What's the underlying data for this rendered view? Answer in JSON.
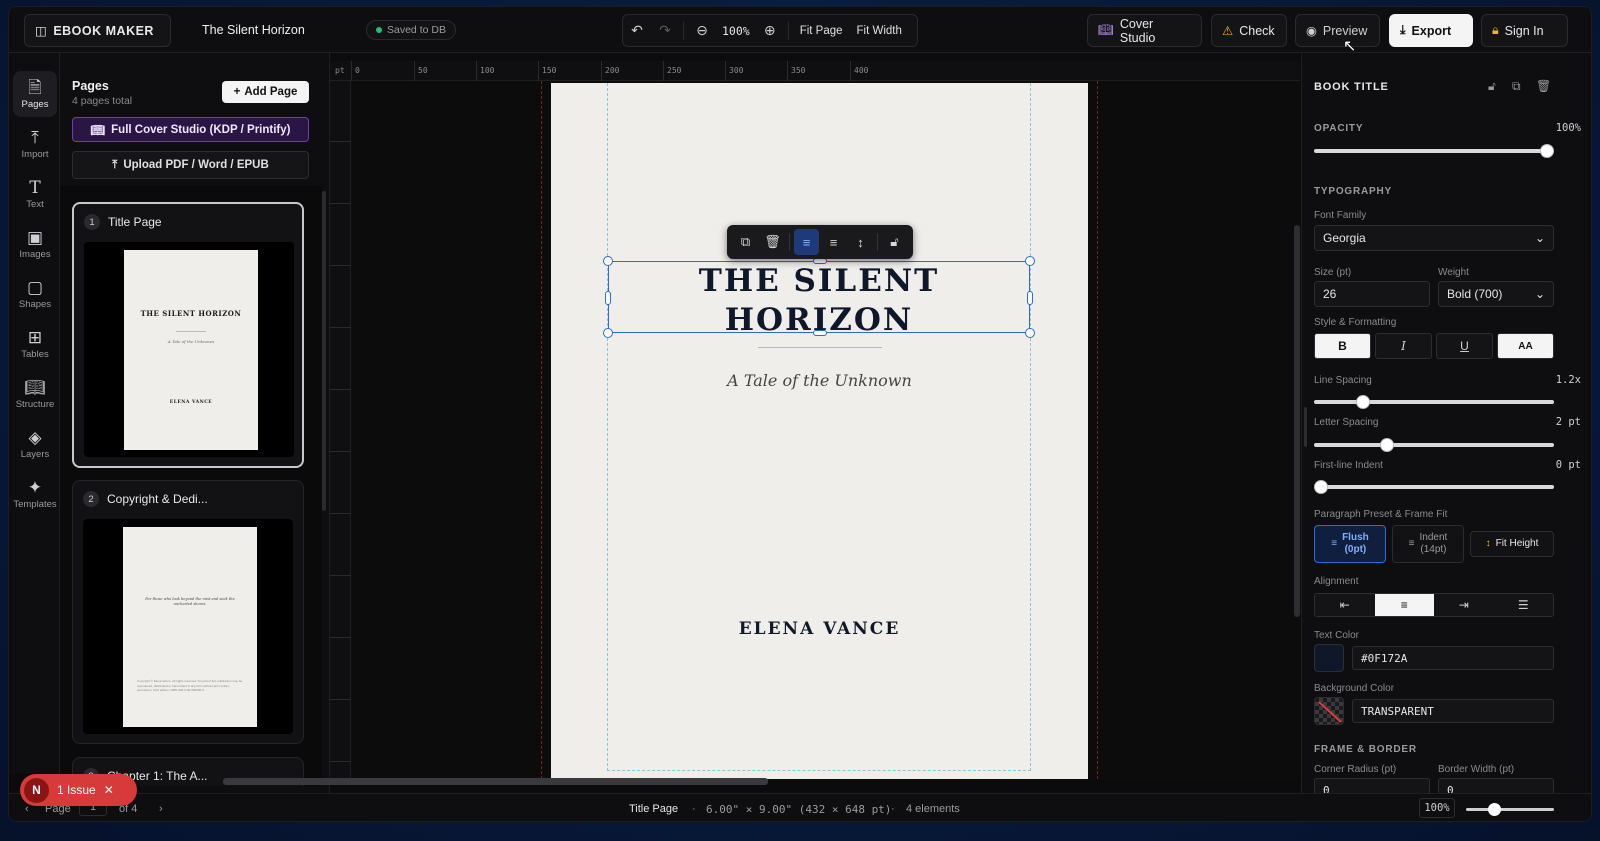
{
  "topbar": {
    "brand": "EBOOK MAKER",
    "doc_title": "The Silent Horizon",
    "saved": "Saved to DB",
    "zoom": "100%",
    "fit_page": "Fit Page",
    "fit_width": "Fit Width",
    "cover_studio": "Cover Studio",
    "check": "Check",
    "preview": "Preview",
    "export": "Export",
    "sign_in": "Sign In"
  },
  "rail": [
    "Pages",
    "Import",
    "Text",
    "Images",
    "Shapes",
    "Tables",
    "Structure",
    "Layers",
    "Templates"
  ],
  "pages_panel": {
    "title": "Pages",
    "subtitle": "4 pages total",
    "add_page": "Add Page",
    "full_cover": "Full Cover Studio (KDP / Printify)",
    "upload": "Upload PDF / Word / EPUB",
    "pages": [
      {
        "num": "1",
        "name": "Title Page",
        "thumb_title": "THE SILENT HORIZON",
        "thumb_sub": "A Tale of the Unknown",
        "thumb_author": "ELENA VANCE"
      },
      {
        "num": "2",
        "name": "Copyright & Dedi...",
        "thumb_dedication": "For those who look beyond the mist and seek the uncharted shores.",
        "thumb_copyright": "Copyright © Elena Vance. All rights reserved. No part of this publication may be reproduced, distributed or transmitted in any form without prior written permission. First edition. ISBN 000-0-00-000000-0"
      },
      {
        "num": "3",
        "name": "Chapter 1: The A..."
      }
    ]
  },
  "canvas": {
    "ruler_unit": "pt",
    "ruler_labels": [
      "0",
      "50",
      "100",
      "150",
      "200",
      "250",
      "300",
      "350",
      "400"
    ],
    "title": "THE SILENT HORIZON",
    "subtitle": "A Tale of the Unknown",
    "author": "ELENA VANCE"
  },
  "properties": {
    "element_title": "BOOK TITLE",
    "opacity_label": "OPACITY",
    "opacity_value": "100%",
    "opacity": 1.0,
    "typography": "TYPOGRAPHY",
    "font_family_label": "Font Family",
    "font_family": "Georgia",
    "size_label": "Size (pt)",
    "size": "26",
    "weight_label": "Weight",
    "weight": "Bold (700)",
    "style_label": "Style & Formatting",
    "style_buttons": [
      "B",
      "I",
      "U",
      "AA"
    ],
    "line_spacing_label": "Line Spacing",
    "line_spacing_value": "1.2x",
    "line_spacing": 1.2,
    "letter_spacing_label": "Letter Spacing",
    "letter_spacing_value": "2 pt",
    "letter_spacing": 2,
    "indent_label": "First-line Indent",
    "indent_value": "0 pt",
    "indent": 0,
    "preset_label": "Paragraph Preset & Frame Fit",
    "preset_flush": "Flush\n(0pt)",
    "preset_indent": "Indent\n(14pt)",
    "fit_height": "Fit Height",
    "alignment_label": "Alignment",
    "text_color_label": "Text Color",
    "text_color": "#0F172A",
    "bg_color_label": "Background Color",
    "bg_color": "TRANSPARENT",
    "frame_border": "FRAME & BORDER",
    "corner_radius_label": "Corner Radius (pt)",
    "corner_radius": "0",
    "border_width_label": "Border Width (pt)",
    "border_width": "0"
  },
  "status": {
    "page_prefix": "Page",
    "page_num": "1",
    "page_of": "of 4",
    "page_name": "Title Page",
    "dimensions": "6.00\" × 9.00\" (432 × 648 pt)",
    "elements": "4 elements",
    "zoom": "100%",
    "issue_letter": "N",
    "issue": "1 Issue"
  },
  "colors": {
    "accent": "#2a6bd9",
    "title_color": "#0f172a",
    "issue_red": "#d63a3a",
    "cover_purple": "#6a3fb0"
  }
}
